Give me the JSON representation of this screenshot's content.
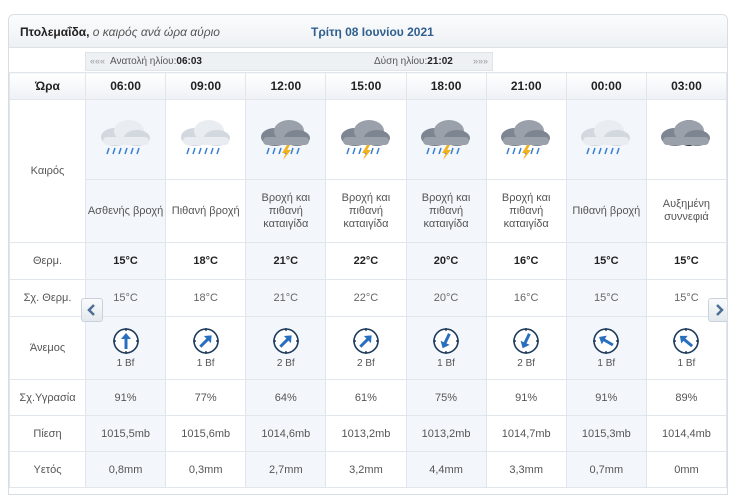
{
  "header": {
    "location": "Πτολεμαΐδα,",
    "subtitle": "ο καιρός ανά ώρα αύριο",
    "date": "Τρίτη 08 Ιουνίου 2021"
  },
  "sun": {
    "sunrise_label": "Ανατολή ηλίου:",
    "sunrise_time": "06:03",
    "sunset_label": "Δύση ηλίου:",
    "sunset_time": "21:02",
    "left_marker": "«««",
    "right_marker": "»»»"
  },
  "labels": {
    "hour": "Ώρα",
    "weather": "Καιρός",
    "temp": "Θερμ.",
    "feels": "Σχ. Θερμ.",
    "wind": "Άνεμος",
    "humidity": "Σχ.Υγρασία",
    "pressure": "Πίεση",
    "rain": "Υετός"
  },
  "hours": [
    {
      "time": "06:00",
      "icon": "light-rain-cloud-icon",
      "cond": "Ασθενής βροχή",
      "temp": "15°C",
      "feels": "15°C",
      "wind_dir": 180,
      "wind": "1 Bf",
      "humidity": "91%",
      "pressure": "1015,5mb",
      "rain": "0,8mm"
    },
    {
      "time": "09:00",
      "icon": "rain-cloud-icon",
      "cond": "Πιθανή βροχή",
      "temp": "18°C",
      "feels": "18°C",
      "wind_dir": 225,
      "wind": "1 Bf",
      "humidity": "77%",
      "pressure": "1015,6mb",
      "rain": "0,3mm"
    },
    {
      "time": "12:00",
      "icon": "thunderstorm-icon",
      "cond": "Βροχή και πιθανή καταιγίδα",
      "temp": "21°C",
      "feels": "21°C",
      "wind_dir": 225,
      "wind": "2 Bf",
      "humidity": "64%",
      "pressure": "1014,6mb",
      "rain": "2,7mm"
    },
    {
      "time": "15:00",
      "icon": "thunderstorm-icon",
      "cond": "Βροχή και πιθανή καταιγίδα",
      "temp": "22°C",
      "feels": "22°C",
      "wind_dir": 225,
      "wind": "2 Bf",
      "humidity": "61%",
      "pressure": "1013,2mb",
      "rain": "3,2mm"
    },
    {
      "time": "18:00",
      "icon": "thunderstorm-icon",
      "cond": "Βροχή και πιθανή καταιγίδα",
      "temp": "20°C",
      "feels": "20°C",
      "wind_dir": 25,
      "wind": "1 Bf",
      "humidity": "75%",
      "pressure": "1013,2mb",
      "rain": "4,4mm"
    },
    {
      "time": "21:00",
      "icon": "thunderstorm-icon",
      "cond": "Βροχή και πιθανή καταιγίδα",
      "temp": "16°C",
      "feels": "16°C",
      "wind_dir": 25,
      "wind": "2 Bf",
      "humidity": "91%",
      "pressure": "1014,7mb",
      "rain": "3,3mm"
    },
    {
      "time": "00:00",
      "icon": "rain-cloud-icon",
      "cond": "Πιθανή βροχή",
      "temp": "15°C",
      "feels": "15°C",
      "wind_dir": 120,
      "wind": "1 Bf",
      "humidity": "91%",
      "pressure": "1015,3mb",
      "rain": "0,7mm"
    },
    {
      "time": "03:00",
      "icon": "night-cloud-icon",
      "cond": "Αυξημένη συννεφιά",
      "temp": "15°C",
      "feels": "15°C",
      "wind_dir": 130,
      "wind": "1 Bf",
      "humidity": "89%",
      "pressure": "1014,4mb",
      "rain": "0mm"
    }
  ]
}
